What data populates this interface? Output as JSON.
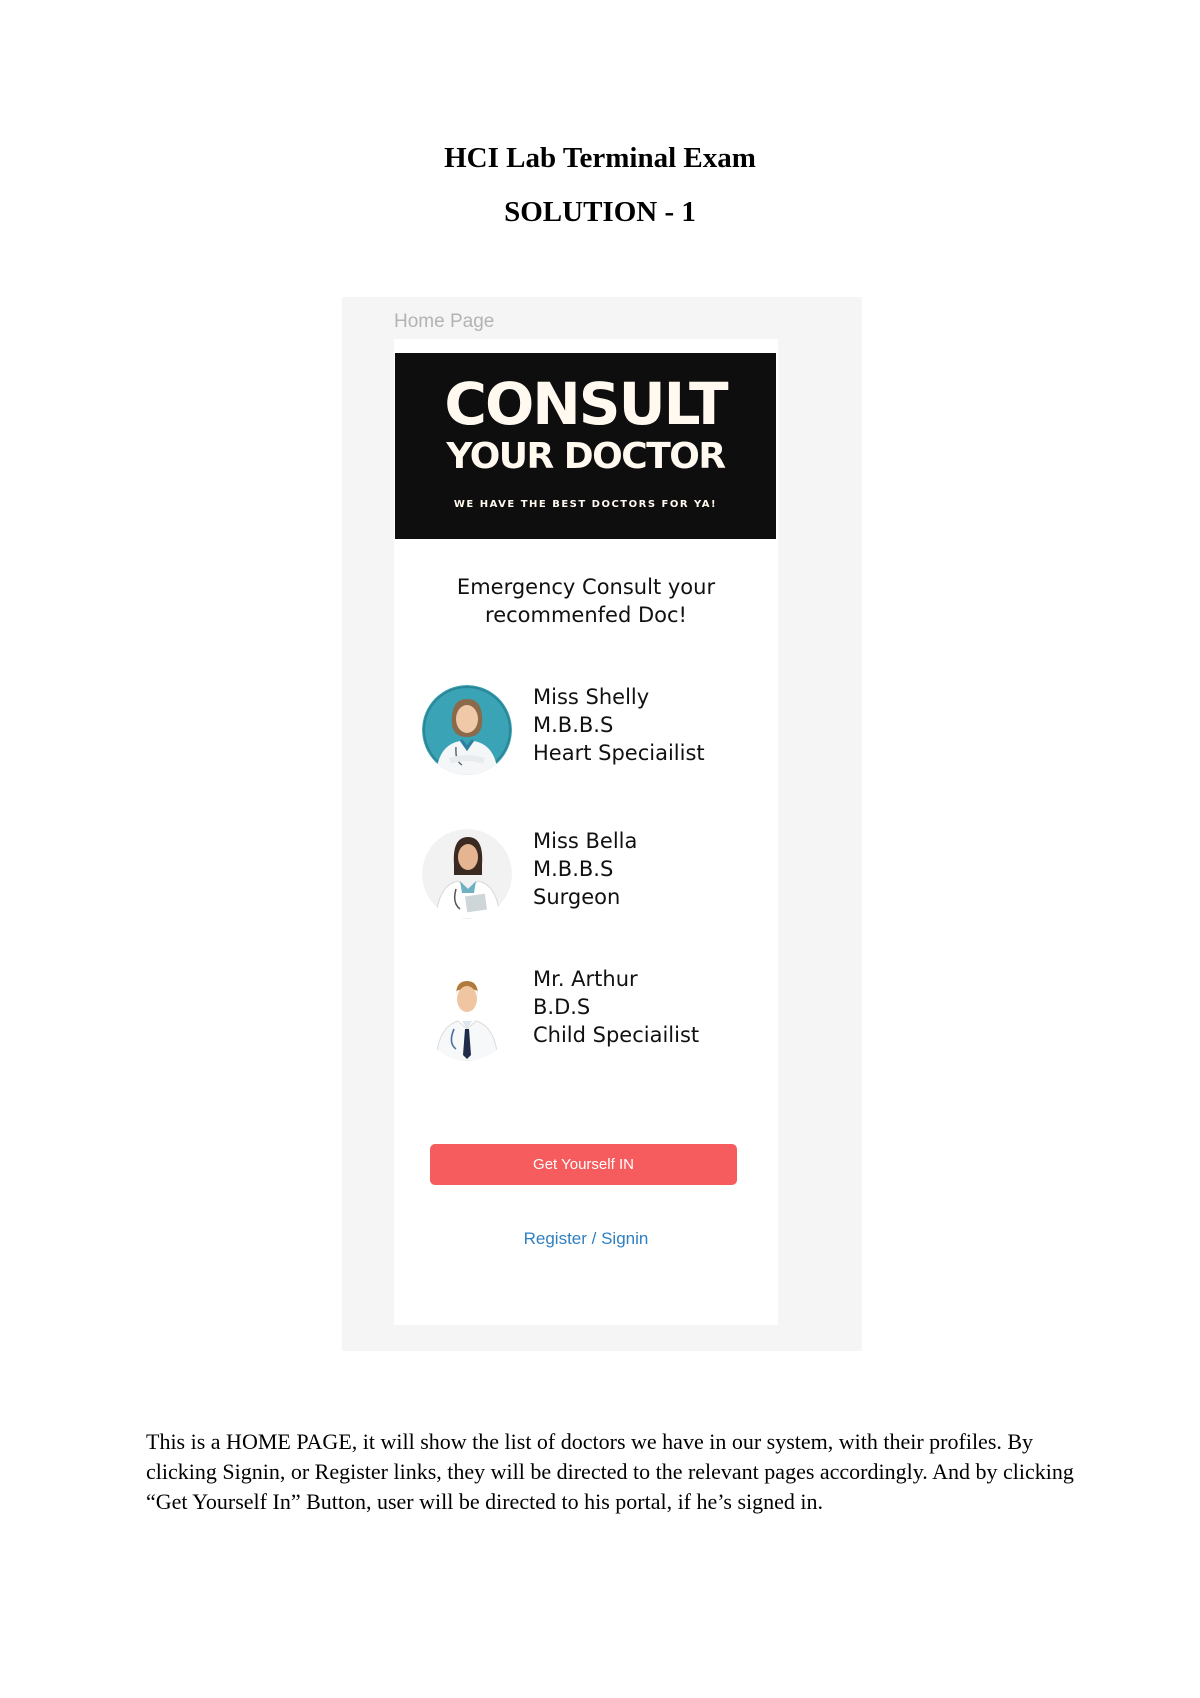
{
  "document": {
    "title": "HCI Lab Terminal Exam",
    "subtitle": "SOLUTION - 1",
    "description": "This is a HOME PAGE, it will show the list of doctors we have in our system, with their profiles. By clicking Signin, or Register links, they will be directed to the relevant pages accordingly. And by clicking “Get Yourself In” Button, user will be directed to his portal, if he’s signed in."
  },
  "frame": {
    "label": "Home Page"
  },
  "banner": {
    "line1": "CONSULT",
    "line2": "YOUR DOCTOR",
    "tagline": "WE HAVE THE BEST DOCTORS FOR YA!"
  },
  "emergency": {
    "line1": "Emergency Consult your",
    "line2": "recommenfed Doc!"
  },
  "doctors": [
    {
      "name": "Miss Shelly",
      "degree": "M.B.B.S",
      "specialty": "Heart Speciailist"
    },
    {
      "name": "Miss Bella",
      "degree": "M.B.B.S",
      "specialty": "Surgeon"
    },
    {
      "name": "Mr. Arthur",
      "degree": "B.D.S",
      "specialty": "Child Speciailist"
    }
  ],
  "actions": {
    "primary_label": "Get Yourself IN",
    "signin_label": "Register / Signin"
  },
  "colors": {
    "banner_bg": "#0e0e0e",
    "cta_bg": "#f65b5d",
    "link": "#2f7fc1"
  }
}
